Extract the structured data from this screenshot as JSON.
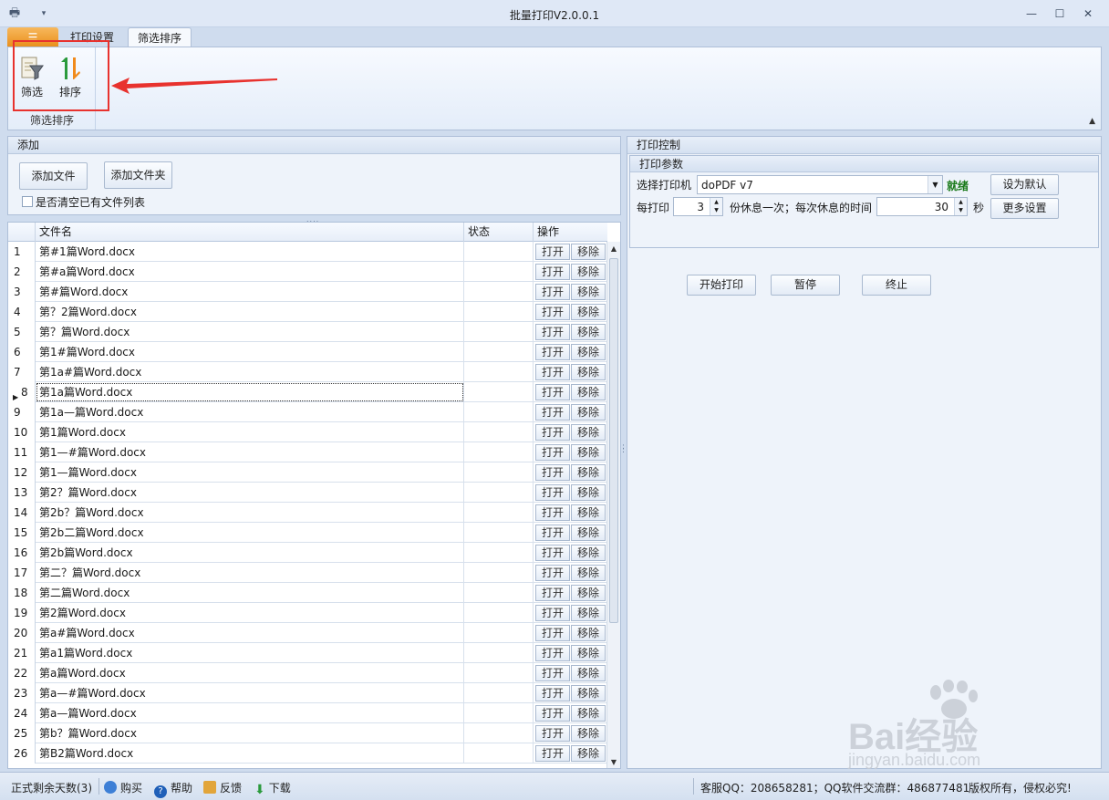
{
  "window": {
    "title": "批量打印V2.0.0.1"
  },
  "ribbon": {
    "tabs": {
      "file": "",
      "print_settings": "打印设置",
      "filter_sort": "筛选排序"
    },
    "group_label": "筛选排序",
    "filter_label": "筛选",
    "sort_label": "排序"
  },
  "add_panel": {
    "title": "添加",
    "add_file": "添加文件",
    "add_folder": "添加文件夹",
    "clear_checkbox": "是否清空已有文件列表"
  },
  "grid": {
    "columns": {
      "filename": "文件名",
      "status": "状态",
      "ops": "操作"
    },
    "open_label": "打开",
    "remove_label": "移除",
    "selected_row": 8,
    "rows": [
      {
        "num": "1",
        "name": "第#1篇Word.docx"
      },
      {
        "num": "2",
        "name": "第#a篇Word.docx"
      },
      {
        "num": "3",
        "name": "第#篇Word.docx"
      },
      {
        "num": "4",
        "name": "第？2篇Word.docx"
      },
      {
        "num": "5",
        "name": "第？篇Word.docx"
      },
      {
        "num": "6",
        "name": "第1#篇Word.docx"
      },
      {
        "num": "7",
        "name": "第1a#篇Word.docx"
      },
      {
        "num": "8",
        "name": "第1a篇Word.docx"
      },
      {
        "num": "9",
        "name": "第1a—篇Word.docx"
      },
      {
        "num": "10",
        "name": "第1篇Word.docx"
      },
      {
        "num": "11",
        "name": "第1—#篇Word.docx"
      },
      {
        "num": "12",
        "name": "第1—篇Word.docx"
      },
      {
        "num": "13",
        "name": "第2？篇Word.docx"
      },
      {
        "num": "14",
        "name": "第2b？篇Word.docx"
      },
      {
        "num": "15",
        "name": "第2b二篇Word.docx"
      },
      {
        "num": "16",
        "name": "第2b篇Word.docx"
      },
      {
        "num": "17",
        "name": "第二？篇Word.docx"
      },
      {
        "num": "18",
        "name": "第二篇Word.docx"
      },
      {
        "num": "19",
        "name": "第2篇Word.docx"
      },
      {
        "num": "20",
        "name": "第a#篇Word.docx"
      },
      {
        "num": "21",
        "name": "第a1篇Word.docx"
      },
      {
        "num": "22",
        "name": "第a篇Word.docx"
      },
      {
        "num": "23",
        "name": "第a—#篇Word.docx"
      },
      {
        "num": "24",
        "name": "第a—篇Word.docx"
      },
      {
        "num": "25",
        "name": "第b？篇Word.docx"
      },
      {
        "num": "26",
        "name": "第B2篇Word.docx"
      }
    ]
  },
  "print_control": {
    "title": "打印控制",
    "params_title": "打印参数",
    "printer_label": "选择打印机",
    "printer_value": "doPDF v7",
    "printer_status": "就绪",
    "set_default": "设为默认",
    "per_print_label": "每打印",
    "copies_value": "3",
    "rest_text": "份休息一次；每次休息的时间",
    "rest_value": "30",
    "seconds": "秒",
    "more_settings": "更多设置",
    "start": "开始打印",
    "pause": "暂停",
    "stop": "终止"
  },
  "statusbar": {
    "days_left": "正式剩余天数(3)",
    "buy": "购买",
    "help": "帮助",
    "feedback": "反馈",
    "download": "下载",
    "contact": "客服QQ：208658281；QQ软件交流群：486877481",
    "copyright": "版权所有，侵权必究!"
  },
  "watermark": {
    "brand": "Bai经验",
    "url": "jingyan.baidu.com"
  },
  "colors": {
    "highlight": "#e8322e",
    "status_ok": "#1a7a1a"
  }
}
